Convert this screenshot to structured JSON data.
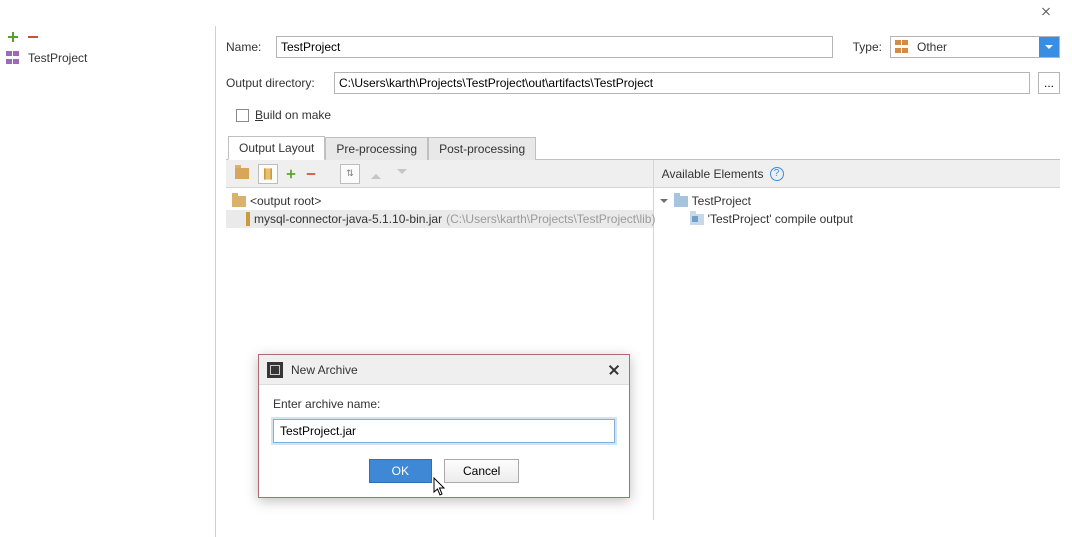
{
  "window": {
    "close_name": "close"
  },
  "sidebar": {
    "add_label": "add",
    "remove_label": "remove",
    "items": [
      {
        "label": "TestProject"
      }
    ]
  },
  "form": {
    "name_label": "Name:",
    "name_value": "TestProject",
    "type_label": "Type:",
    "type_value": "Other",
    "output_label": "Output directory:",
    "output_value": "C:\\Users\\karth\\Projects\\TestProject\\out\\artifacts\\TestProject",
    "browse_label": "...",
    "build_on_make_label": "Build on make"
  },
  "tabs": [
    {
      "label": "Output Layout",
      "active": true
    },
    {
      "label": "Pre-processing",
      "active": false
    },
    {
      "label": "Post-processing",
      "active": false
    }
  ],
  "left": {
    "root_label": "<output root>",
    "entries": [
      {
        "name": "mysql-connector-java-5.1.10-bin.jar",
        "path": " (C:\\Users\\karth\\Projects\\TestProject\\lib)"
      }
    ]
  },
  "right": {
    "header": "Available Elements",
    "help": "?",
    "project": "TestProject",
    "module_output": "'TestProject' compile output"
  },
  "dialog": {
    "title": "New Archive",
    "prompt": "Enter archive name:",
    "value": "TestProject.jar",
    "ok": "OK",
    "cancel": "Cancel"
  }
}
